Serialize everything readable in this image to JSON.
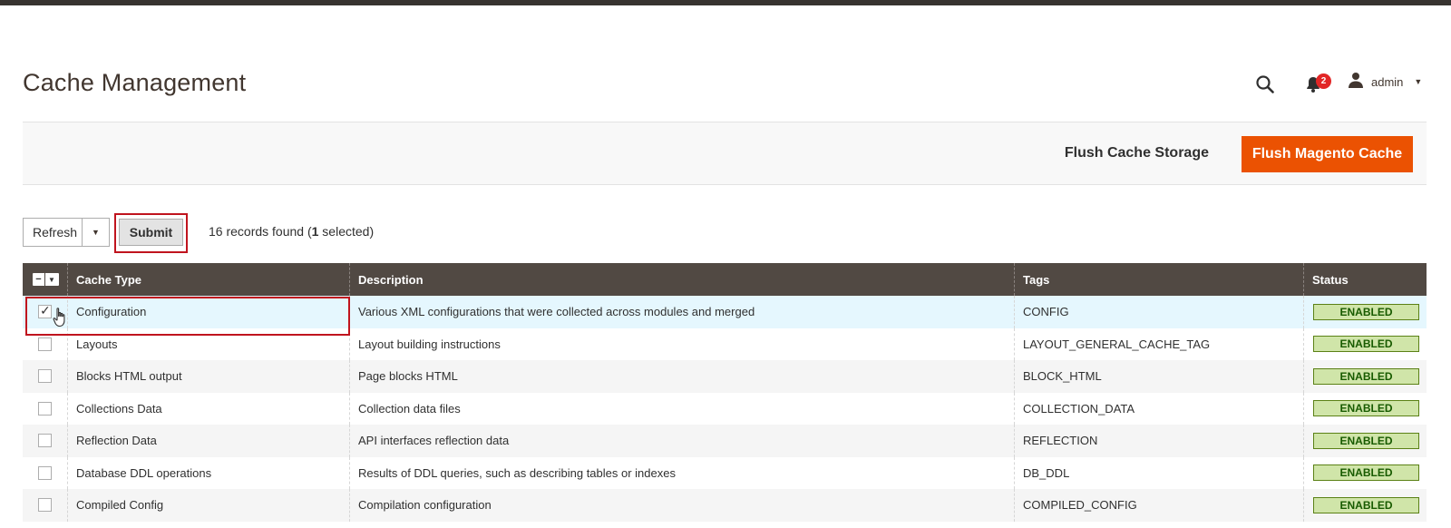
{
  "header": {
    "title": "Cache Management",
    "notification_count": "2",
    "user_label": "admin"
  },
  "actions": {
    "flush_storage_label": "Flush Cache Storage",
    "flush_magento_label": "Flush Magento Cache"
  },
  "toolbar": {
    "mass_action_value": "Refresh",
    "submit_label": "Submit",
    "records_prefix": "16 records found (",
    "selected_count": "1",
    "records_suffix": " selected)"
  },
  "grid": {
    "columns": [
      "Cache Type",
      "Description",
      "Tags",
      "Status"
    ],
    "rows": [
      {
        "type": "Configuration",
        "description": "Various XML configurations that were collected across modules and merged",
        "tags": "CONFIG",
        "status": "ENABLED",
        "checked": true
      },
      {
        "type": "Layouts",
        "description": "Layout building instructions",
        "tags": "LAYOUT_GENERAL_CACHE_TAG",
        "status": "ENABLED",
        "checked": false
      },
      {
        "type": "Blocks HTML output",
        "description": "Page blocks HTML",
        "tags": "BLOCK_HTML",
        "status": "ENABLED",
        "checked": false
      },
      {
        "type": "Collections Data",
        "description": "Collection data files",
        "tags": "COLLECTION_DATA",
        "status": "ENABLED",
        "checked": false
      },
      {
        "type": "Reflection Data",
        "description": "API interfaces reflection data",
        "tags": "REFLECTION",
        "status": "ENABLED",
        "checked": false
      },
      {
        "type": "Database DDL operations",
        "description": "Results of DDL queries, such as describing tables or indexes",
        "tags": "DB_DDL",
        "status": "ENABLED",
        "checked": false
      },
      {
        "type": "Compiled Config",
        "description": "Compilation configuration",
        "tags": "COMPILED_CONFIG",
        "status": "ENABLED",
        "checked": false
      }
    ]
  },
  "colors": {
    "accent": "#eb5202",
    "header_bg": "#514943",
    "enabled_bg": "#d0e5a9",
    "highlight": "#c0141e"
  },
  "icons": {
    "search": "search-icon",
    "notifications": "bell-icon",
    "user": "user-icon"
  }
}
